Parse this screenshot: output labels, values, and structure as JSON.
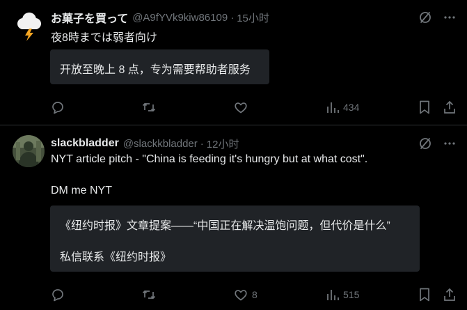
{
  "posts": [
    {
      "author": {
        "display_name": "お菓子を買って",
        "handle": "@A9fYVk9kiw86109",
        "avatar_icon": "storm-cloud-lightning-icon"
      },
      "time": "15小时",
      "separator": "·",
      "text_lines": [
        "夜8時までは弱者向け"
      ],
      "translation_lines": [
        "开放至晚上 8 点，专为需要帮助者服务"
      ],
      "actions": {
        "reply": "",
        "repost": "",
        "like": "",
        "views": "434"
      }
    },
    {
      "author": {
        "display_name": "slackbladder",
        "handle": "@slackkbladder",
        "avatar_icon": "profile-photo"
      },
      "time": "12小时",
      "separator": "·",
      "text_lines": [
        "NYT article pitch - \"China is feeding it's hungry but at what cost\".",
        "DM me NYT"
      ],
      "translation_lines": [
        "《纽约时报》文章提案——“中国正在解决温饱问题，但代价是什么”",
        "私信联系《纽约时报》"
      ],
      "actions": {
        "reply": "",
        "repost": "",
        "like": "8",
        "views": "515"
      }
    }
  ],
  "colors": {
    "background": "#000000",
    "text": "#e7e9ea",
    "muted": "#71767b",
    "box": "#202327",
    "divider": "#2f3336"
  }
}
